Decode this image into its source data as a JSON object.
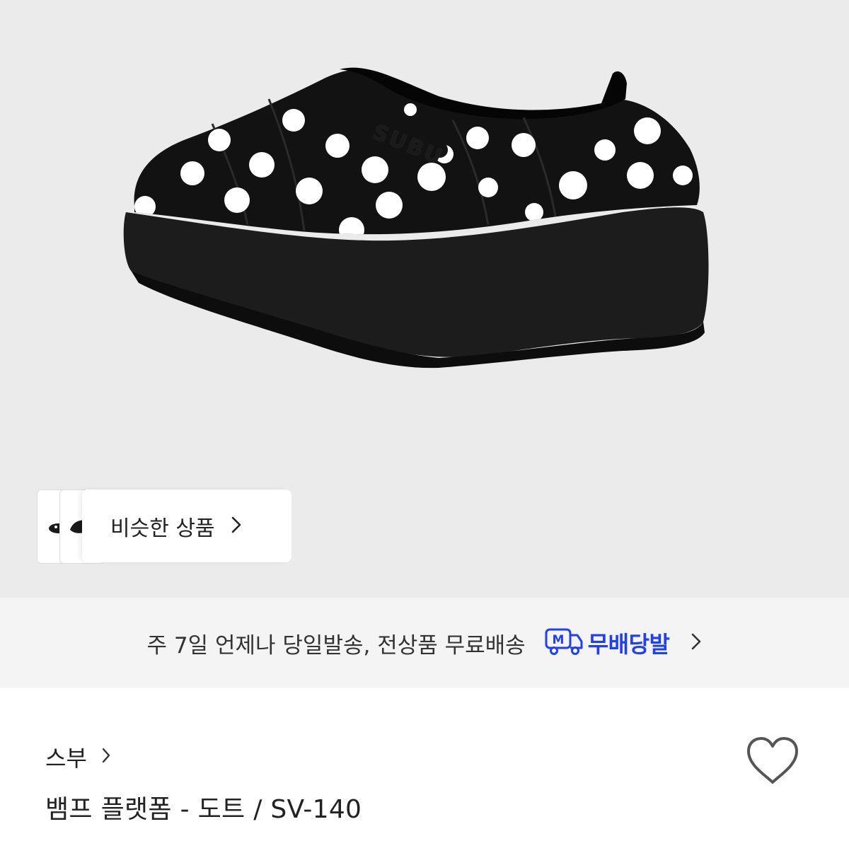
{
  "product_image": {
    "brand_logo": "SUBU",
    "colors": {
      "background": "#ebebeb",
      "upper": "#111111",
      "dots": "#ffffff",
      "sole": "#1c1c1c"
    }
  },
  "similar_products": {
    "label": "비슷한 상품",
    "icon": "chevron-right-icon"
  },
  "shipping_banner": {
    "text": "주 7일 언제나 당일발송, 전상품 무료배송",
    "badge_icon_letter": "M",
    "badge_label": "무배당발",
    "accent_color": "#1f3ff0",
    "icon": "chevron-right-icon"
  },
  "product": {
    "brand": "스부",
    "title": "뱀프 플랫폼 - 도트 / SV-140",
    "wishlist_icon": "heart-outline-icon"
  }
}
